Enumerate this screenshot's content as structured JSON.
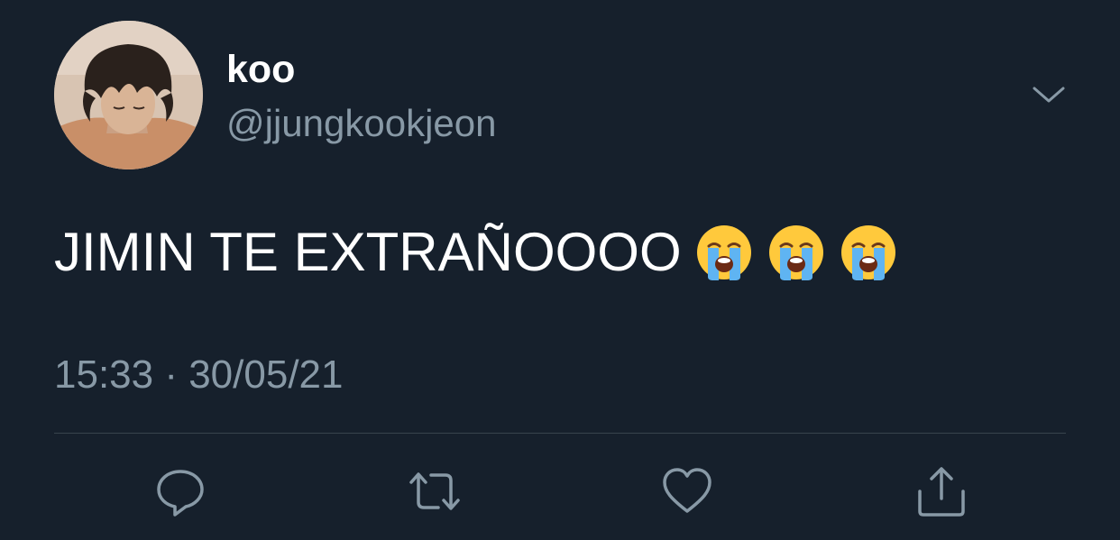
{
  "tweet": {
    "author": {
      "display_name": "koo",
      "handle": "@jjungkookjeon",
      "avatar": "profile-photo"
    },
    "text": "JIMIN TE EXTRAÑOOOO",
    "emojis": [
      "loudly-crying-face",
      "loudly-crying-face",
      "loudly-crying-face"
    ],
    "timestamp": "15:33 · 30/05/21",
    "actions": [
      {
        "name": "reply",
        "icon": "speech-bubble-icon"
      },
      {
        "name": "retweet",
        "icon": "retweet-icon"
      },
      {
        "name": "like",
        "icon": "heart-icon"
      },
      {
        "name": "share",
        "icon": "share-icon"
      }
    ],
    "menu_icon": "chevron-down-icon"
  },
  "colors": {
    "background": "#16202c",
    "text_primary": "#ffffff",
    "text_secondary": "#8899a6",
    "divider": "#38444d"
  }
}
